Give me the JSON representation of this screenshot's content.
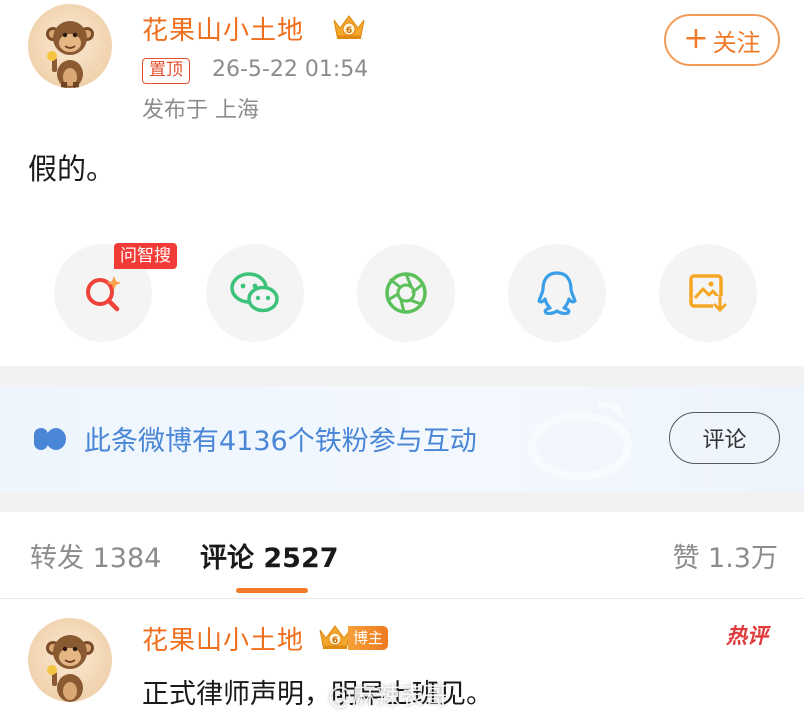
{
  "post": {
    "username": "花果山小土地",
    "pinned_label": "置顶",
    "timestamp": "26-5-22 01:54",
    "location": "发布于 上海",
    "content": "假的。",
    "follow_plus": "+",
    "follow_label": "关注"
  },
  "share": {
    "new_badge": "问智搜",
    "items": [
      {
        "icon": "search-ai-icon",
        "color": "#f0443a"
      },
      {
        "icon": "wechat-icon",
        "color": "#3cc27a"
      },
      {
        "icon": "moments-icon",
        "color": "#5cc05a"
      },
      {
        "icon": "qq-icon",
        "color": "#3a9ee8"
      },
      {
        "icon": "save-image-icon",
        "color": "#f5a623"
      }
    ]
  },
  "banner": {
    "text": "此条微博有4136个铁粉参与互动",
    "button_label": "评论"
  },
  "tabs": {
    "repost": "转发 1384",
    "comments": "评论 2527",
    "likes": "赞 1.3万"
  },
  "comment": {
    "username": "花果山小土地",
    "badge": "博主",
    "hot_label": "热评",
    "text": "正式律师声明，明早上班见。",
    "watermark": "@麻辣表哥"
  },
  "colors": {
    "accent": "#f07a2a",
    "link_blue": "#4a86d6",
    "red": "#f23b36"
  }
}
